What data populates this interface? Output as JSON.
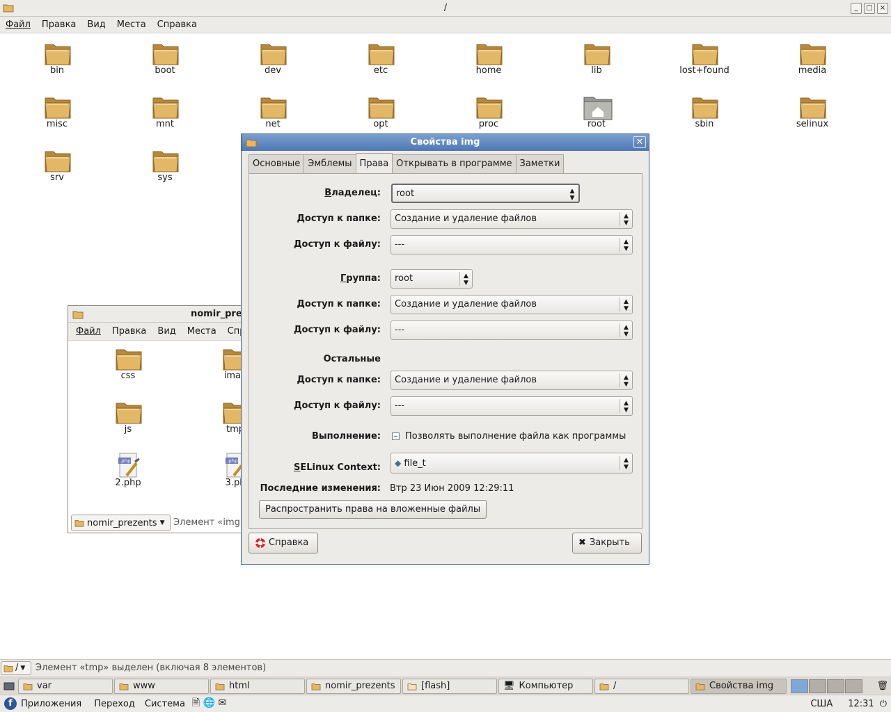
{
  "main_window": {
    "title": "/",
    "menu": [
      "Файл",
      "Правка",
      "Вид",
      "Места",
      "Справка"
    ],
    "buttons": [
      "_",
      "□",
      "×"
    ]
  },
  "desktop_icons": [
    {
      "label": "bin",
      "type": "folder"
    },
    {
      "label": "boot",
      "type": "folder"
    },
    {
      "label": "dev",
      "type": "folder"
    },
    {
      "label": "etc",
      "type": "folder"
    },
    {
      "label": "home",
      "type": "folder"
    },
    {
      "label": "lib",
      "type": "folder"
    },
    {
      "label": "lost+found",
      "type": "folder"
    },
    {
      "label": "media",
      "type": "folder"
    },
    {
      "label": "misc",
      "type": "folder"
    },
    {
      "label": "mnt",
      "type": "folder"
    },
    {
      "label": "net",
      "type": "folder"
    },
    {
      "label": "opt",
      "type": "folder"
    },
    {
      "label": "proc",
      "type": "folder"
    },
    {
      "label": "root",
      "type": "home-folder"
    },
    {
      "label": "sbin",
      "type": "folder"
    },
    {
      "label": "selinux",
      "type": "folder"
    },
    {
      "label": "srv",
      "type": "folder"
    },
    {
      "label": "sys",
      "type": "folder"
    }
  ],
  "nomir_window": {
    "title": "nomir_pre",
    "menu": [
      "Файл",
      "Правка",
      "Вид",
      "Места",
      "Спр"
    ],
    "items": [
      {
        "label": "css",
        "type": "folder"
      },
      {
        "label": "imag",
        "type": "folder"
      },
      {
        "label": "js",
        "type": "folder"
      },
      {
        "label": "tmp",
        "type": "folder"
      },
      {
        "label": "2.php",
        "type": "php"
      },
      {
        "label": "3.ph",
        "type": "php"
      }
    ],
    "location": "nomir_prezents",
    "status": "Элемент «img"
  },
  "dialog": {
    "title": "Свойства img",
    "tabs": [
      "Основные",
      "Эмблемы",
      "Права",
      "Открывать в программе",
      "Заметки"
    ],
    "active_tab": "Права",
    "owner_label": "Владелец:",
    "owner_value": "root",
    "owner_folder_label": "Доступ к папке:",
    "owner_folder_value": "Создание и удаление файлов",
    "owner_file_label": "Доступ к файлу:",
    "owner_file_value": "---",
    "group_label": "Группа:",
    "group_value": "root",
    "group_folder_label": "Доступ к папке:",
    "group_folder_value": "Создание и удаление файлов",
    "group_file_label": "Доступ к файлу:",
    "group_file_value": "---",
    "others_label": "Остальные",
    "others_folder_label": "Доступ к папке:",
    "others_folder_value": "Создание и удаление файлов",
    "others_file_label": "Доступ к файлу:",
    "others_file_value": "---",
    "exec_label": "Выполнение:",
    "exec_checkbox": "Позволять выполнение файла как программы",
    "selinux_label": "SELinux Context:",
    "selinux_value": "file_t",
    "modified_label": "Последние изменения:",
    "modified_value": "Втр 23 Июн 2009 12:29:11",
    "apply_button": "Распространить права на вложенные файлы",
    "help_button": "Справка",
    "close_button": "Закрыть"
  },
  "statusbar": {
    "location": "/",
    "text": "Элемент «tmp» выделен (включая 8 элементов)"
  },
  "taskbar": {
    "tasks": [
      {
        "label": "var",
        "active": false
      },
      {
        "label": "www",
        "active": false
      },
      {
        "label": "html",
        "active": false
      },
      {
        "label": "nomir_prezents",
        "active": false
      },
      {
        "label": "[flash]",
        "active": false
      },
      {
        "label": "Компьютер",
        "active": false
      },
      {
        "label": "/",
        "active": false
      },
      {
        "label": "Свойства img",
        "active": true
      }
    ]
  },
  "panel": {
    "menus": [
      "Приложения",
      "Переход",
      "Система"
    ],
    "keyboard": "США",
    "time": "12:31"
  },
  "colors": {
    "folder": "#e2b766",
    "folder_dark": "#b8893c",
    "dialog_title": "#4f77b3",
    "window_bg": "#edebe8"
  }
}
